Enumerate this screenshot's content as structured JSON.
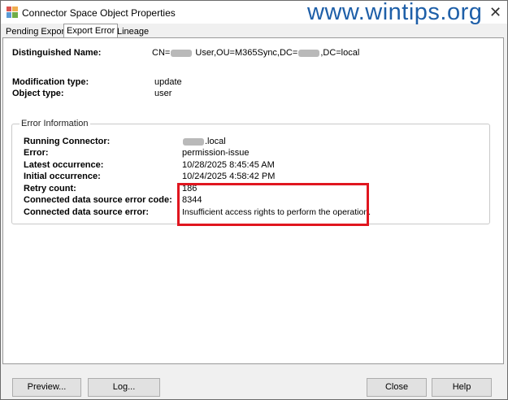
{
  "window": {
    "title": "Connector Space Object Properties"
  },
  "watermark": "www.wintips.org",
  "tabs": [
    {
      "label": "Pending Export"
    },
    {
      "label": "Export Error"
    },
    {
      "label": "Lineage"
    }
  ],
  "fields": {
    "distinguished_name": {
      "label": "Distinguished Name:",
      "value_prefix": "CN=",
      "value_mid": " User,OU=M365Sync,DC=",
      "value_suffix": ",DC=local"
    },
    "modification_type": {
      "label": "Modification type:",
      "value": "update"
    },
    "object_type": {
      "label": "Object type:",
      "value": "user"
    }
  },
  "error_info": {
    "title": "Error Information",
    "running_connector": {
      "label": "Running Connector:",
      "value_suffix": ".local"
    },
    "error": {
      "label": "Error:",
      "value": "permission-issue"
    },
    "latest_occurrence": {
      "label": "Latest occurrence:",
      "value": "10/28/2025 8:45:45 AM"
    },
    "initial_occurrence": {
      "label": "Initial occurrence:",
      "value": "10/24/2025 4:58:42 PM"
    },
    "retry_count": {
      "label": "Retry count:",
      "value": "186"
    },
    "error_code": {
      "label": "Connected data source error code:",
      "value": "8344"
    },
    "error_text": {
      "label": "Connected data source error:",
      "value": "Insufficient access rights to perform the operation."
    }
  },
  "buttons": {
    "preview": "Preview...",
    "log": "Log...",
    "close": "Close",
    "help": "Help"
  },
  "colors": {
    "highlight": "#e0161f",
    "watermark": "#1e5fa8"
  }
}
